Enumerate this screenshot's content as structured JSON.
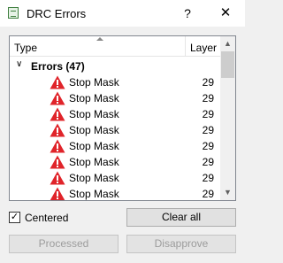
{
  "window": {
    "title": "DRC Errors",
    "help": "?",
    "close": "✕"
  },
  "list": {
    "columns": {
      "type": "Type",
      "layer": "Layer"
    },
    "group": {
      "label": "Errors (47)",
      "expanded": true
    },
    "rows": [
      {
        "type": "Stop Mask",
        "layer": "29"
      },
      {
        "type": "Stop Mask",
        "layer": "29"
      },
      {
        "type": "Stop Mask",
        "layer": "29"
      },
      {
        "type": "Stop Mask",
        "layer": "29"
      },
      {
        "type": "Stop Mask",
        "layer": "29"
      },
      {
        "type": "Stop Mask",
        "layer": "29"
      },
      {
        "type": "Stop Mask",
        "layer": "29"
      },
      {
        "type": "Stop Mask",
        "layer": "29"
      }
    ],
    "row_icon": "warning-icon"
  },
  "options": {
    "centered_label": "Centered",
    "centered_checked": true
  },
  "buttons": {
    "clear_all": "Clear all",
    "processed": "Processed",
    "disapprove": "Disapprove"
  },
  "colors": {
    "warning_red": "#e0242a",
    "background": "#f0f0f0"
  }
}
